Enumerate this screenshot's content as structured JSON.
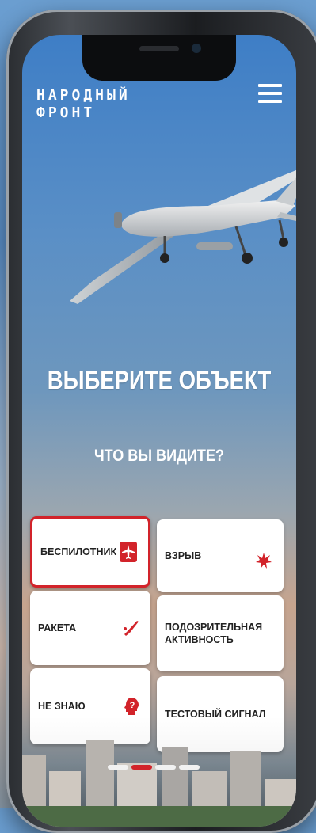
{
  "brand": {
    "line1": "НАРОДНЫЙ",
    "line2": "ФРОНТ"
  },
  "header": {
    "menu_icon": "hamburger-menu-icon"
  },
  "hero": {
    "image": "drone-illustration"
  },
  "main": {
    "title": "ВЫБЕРИТЕ ОБЪЕКТ",
    "subtitle": "ЧТО ВЫ ВИДИТЕ?"
  },
  "options": [
    {
      "label": "БЕСПИЛОТНИК",
      "icon": "airplane-icon",
      "selected": true
    },
    {
      "label": "ВЗРЫВ",
      "icon": "explosion-icon",
      "selected": false
    },
    {
      "label": "РАКЕТА",
      "icon": "missile-icon",
      "selected": false
    },
    {
      "label": "ПОДОЗРИТЕЛЬНАЯ АКТИВНОСТЬ",
      "icon": "none",
      "selected": false
    },
    {
      "label": "НЕ ЗНАЮ",
      "icon": "question-head-icon",
      "selected": false
    },
    {
      "label": "ТЕСТОВЫЙ СИГНАЛ",
      "icon": "none",
      "selected": false
    }
  ],
  "pager": {
    "pages": 4,
    "current": 2
  },
  "colors": {
    "accent": "#d2232a",
    "tile_bg": "#ffffff",
    "text": "#222222"
  }
}
